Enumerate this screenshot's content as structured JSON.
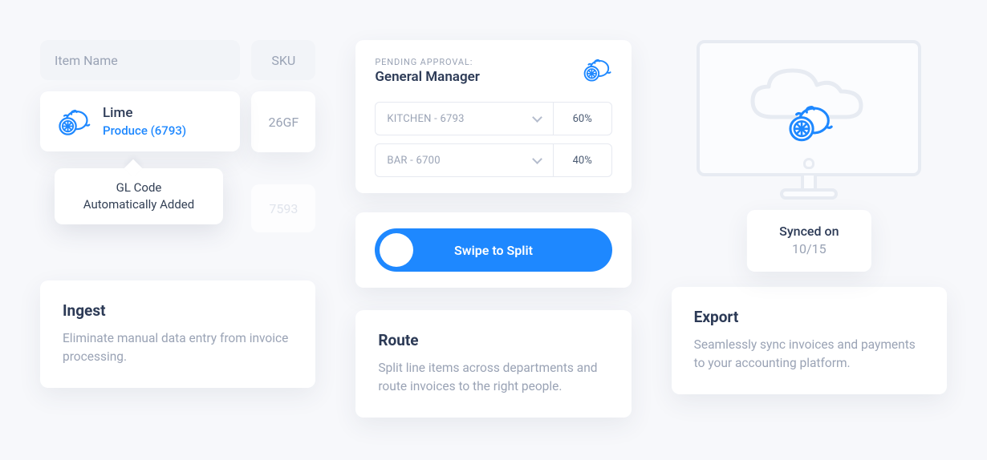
{
  "ingest": {
    "header_item_name": "Item Name",
    "header_sku": "SKU",
    "item_name": "Lime",
    "item_sub": "Produce (6793)",
    "sku": "26GF",
    "ghost_sku": "7593",
    "tooltip_line1": "GL Code",
    "tooltip_line2": "Automatically Added",
    "feature_title": "Ingest",
    "feature_body": "Eliminate manual data entry from invoice processing."
  },
  "route": {
    "eyebrow": "PENDING APPROVAL:",
    "approver": "General Manager",
    "rows": [
      {
        "label": "KITCHEN - 6793",
        "pct": "60%"
      },
      {
        "label": "BAR - 6700",
        "pct": "40%"
      }
    ],
    "swipe_label": "Swipe to Split",
    "feature_title": "Route",
    "feature_body": "Split line items across departments and route invoices to the right people."
  },
  "export": {
    "synced_label": "Synced on",
    "synced_date": "10/15",
    "feature_title": "Export",
    "feature_body": "Seamlessly sync invoices and payments to your accounting platform."
  }
}
